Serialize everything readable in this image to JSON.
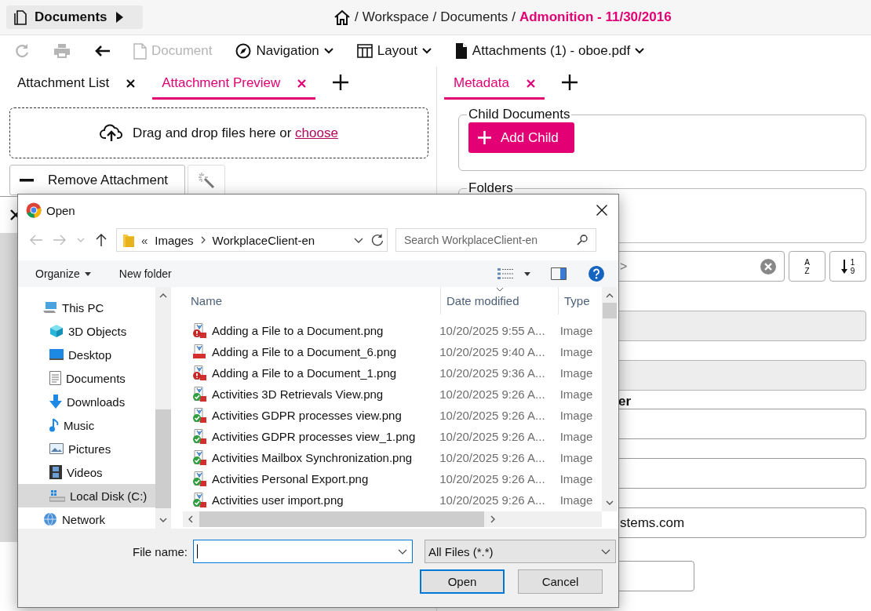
{
  "top_bar": {
    "documents_button": {
      "label": "Documents"
    },
    "breadcrumb": [
      {
        "separator": "/",
        "label": "Workspace",
        "current": false
      },
      {
        "separator": "/",
        "label": "Documents",
        "current": false
      },
      {
        "separator": "/",
        "label": "Admonition - 11/30/2016",
        "current": true
      }
    ]
  },
  "toolbar": [
    {
      "kind": "refresh",
      "disabled": true
    },
    {
      "kind": "print",
      "disabled": true
    },
    {
      "kind": "back",
      "disabled": false
    },
    {
      "kind": "document",
      "label": "Document",
      "disabled": true
    },
    {
      "kind": "navigation",
      "label": "Navigation",
      "disabled": false
    },
    {
      "kind": "layout",
      "label": "Layout",
      "disabled": false
    },
    {
      "kind": "attachments",
      "label": "Attachments (1) - oboe.pdf",
      "disabled": false
    }
  ],
  "left_panel": {
    "tabs": [
      {
        "label": "Attachment List",
        "selected": false
      },
      {
        "label": "Attachment Preview",
        "selected": true
      }
    ],
    "dropzone": {
      "text": "Drag and drop files here or",
      "link": "choose"
    },
    "remove_button": "Remove Attachment"
  },
  "right_panel": {
    "tabs": [
      {
        "label": "Metadata",
        "selected": true
      }
    ],
    "child_documents": {
      "legend": "Child Documents",
      "button": "Add Child"
    },
    "folders": {
      "legend": "Folders"
    },
    "filter": {
      "placeholder": ">"
    },
    "sort_buttons": [
      {
        "kind": "alpha",
        "upper": "A",
        "lower": "Z"
      },
      {
        "kind": "numeric",
        "upper": "1",
        "lower": "9"
      }
    ],
    "fields": [
      {
        "kind": "full",
        "disabled": true
      },
      {
        "kind": "full",
        "disabled": true
      },
      {
        "kind": "full",
        "disabled": false,
        "label": "er"
      },
      {
        "kind": "full",
        "disabled": false
      },
      {
        "kind": "full",
        "disabled": false,
        "value": "stems.com"
      },
      {
        "kind": "short",
        "disabled": false
      }
    ]
  },
  "dialog": {
    "title": "Open",
    "address": {
      "overflow": "«",
      "path": [
        "Images",
        "WorkplaceClient-en"
      ]
    },
    "search": {
      "placeholder": "Search WorkplaceClient-en"
    },
    "commands": {
      "organize": "Organize",
      "new_folder": "New folder"
    },
    "nav": [
      {
        "label": "This PC",
        "kind": "pc",
        "selected": false,
        "children": [
          {
            "label": "3D Objects",
            "kind": "objects3d",
            "selected": false
          },
          {
            "label": "Desktop",
            "kind": "desktop",
            "selected": false
          },
          {
            "label": "Documents",
            "kind": "documents",
            "selected": false
          },
          {
            "label": "Downloads",
            "kind": "downloads",
            "selected": false
          },
          {
            "label": "Music",
            "kind": "music",
            "selected": false
          },
          {
            "label": "Pictures",
            "kind": "pictures",
            "selected": false
          },
          {
            "label": "Videos",
            "kind": "videos",
            "selected": false
          },
          {
            "label": "Local Disk (C:)",
            "kind": "disk",
            "selected": true
          }
        ]
      },
      {
        "label": "Network",
        "kind": "network",
        "selected": false
      }
    ],
    "columns": [
      {
        "label": "Name",
        "sorted": false
      },
      {
        "label": "Date modified",
        "sorted": true
      },
      {
        "label": "Type",
        "sorted": false
      }
    ],
    "files": [
      {
        "name": "Adding a File to a Document.png",
        "date": "10/20/2025 9:55 A...",
        "type": "Image",
        "kind": "warning"
      },
      {
        "name": "Adding a File to a Document_6.png",
        "date": "10/20/2025 9:40 A...",
        "type": "Image",
        "kind": "png"
      },
      {
        "name": "Adding a File to a Document_1.png",
        "date": "10/20/2025 9:36 A...",
        "type": "Image",
        "kind": "warning"
      },
      {
        "name": "Activities 3D Retrievals View.png",
        "date": "10/20/2025 9:26 A...",
        "type": "Image",
        "kind": "ok"
      },
      {
        "name": "Activities GDPR processes view.png",
        "date": "10/20/2025 9:26 A...",
        "type": "Image",
        "kind": "ok"
      },
      {
        "name": "Activities GDPR processes view_1.png",
        "date": "10/20/2025 9:26 A...",
        "type": "Image",
        "kind": "ok"
      },
      {
        "name": "Activities Mailbox Synchronization.png",
        "date": "10/20/2025 9:26 A...",
        "type": "Image",
        "kind": "ok"
      },
      {
        "name": "Activities Personal Export.png",
        "date": "10/20/2025 9:26 A...",
        "type": "Image",
        "kind": "ok"
      },
      {
        "name": "Activities user import.png",
        "date": "10/20/2025 9:26 A...",
        "type": "Image",
        "kind": "ok"
      }
    ],
    "file_name": {
      "label": "File name:"
    },
    "file_type": {
      "value": "All Files (*.*)"
    },
    "buttons": [
      {
        "label": "Open",
        "default": true
      },
      {
        "label": "Cancel",
        "default": false
      }
    ]
  }
}
